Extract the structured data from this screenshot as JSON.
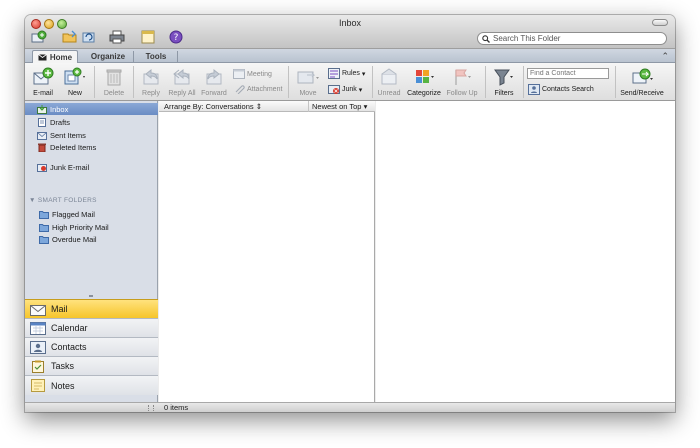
{
  "window": {
    "title": "Inbox"
  },
  "search": {
    "placeholder": "Search This Folder"
  },
  "tabs": [
    {
      "label": "Home"
    },
    {
      "label": "Organize"
    },
    {
      "label": "Tools"
    }
  ],
  "ribbon": {
    "email": "E-mail",
    "new": "New",
    "delete": "Delete",
    "reply": "Reply",
    "reply_all": "Reply All",
    "forward": "Forward",
    "meeting": "Meeting",
    "attachment": "Attachment",
    "move": "Move",
    "rules": "Rules",
    "junk": "Junk",
    "unread": "Unread",
    "categorize": "Categorize",
    "follow_up": "Follow Up",
    "filters": "Filters",
    "find_contact_placeholder": "Find a Contact",
    "contacts_search": "Contacts Search",
    "send_receive": "Send/Receive"
  },
  "folders": {
    "inbox": "Inbox",
    "drafts": "Drafts",
    "sent": "Sent Items",
    "deleted": "Deleted Items",
    "junk": "Junk E-mail",
    "smart_header": "SMART FOLDERS",
    "flagged": "Flagged Mail",
    "high_priority": "High Priority Mail",
    "overdue": "Overdue Mail"
  },
  "nav": {
    "mail": "Mail",
    "calendar": "Calendar",
    "contacts": "Contacts",
    "tasks": "Tasks",
    "notes": "Notes"
  },
  "list": {
    "arrange_by": "Arrange By: Conversations",
    "order": "Newest on Top"
  },
  "status": {
    "items": "0 items"
  },
  "colors": {
    "nav_active": "#f6c52b",
    "folder_selected": "#7a9acd",
    "sidebar_bg": "#d9dee7"
  }
}
